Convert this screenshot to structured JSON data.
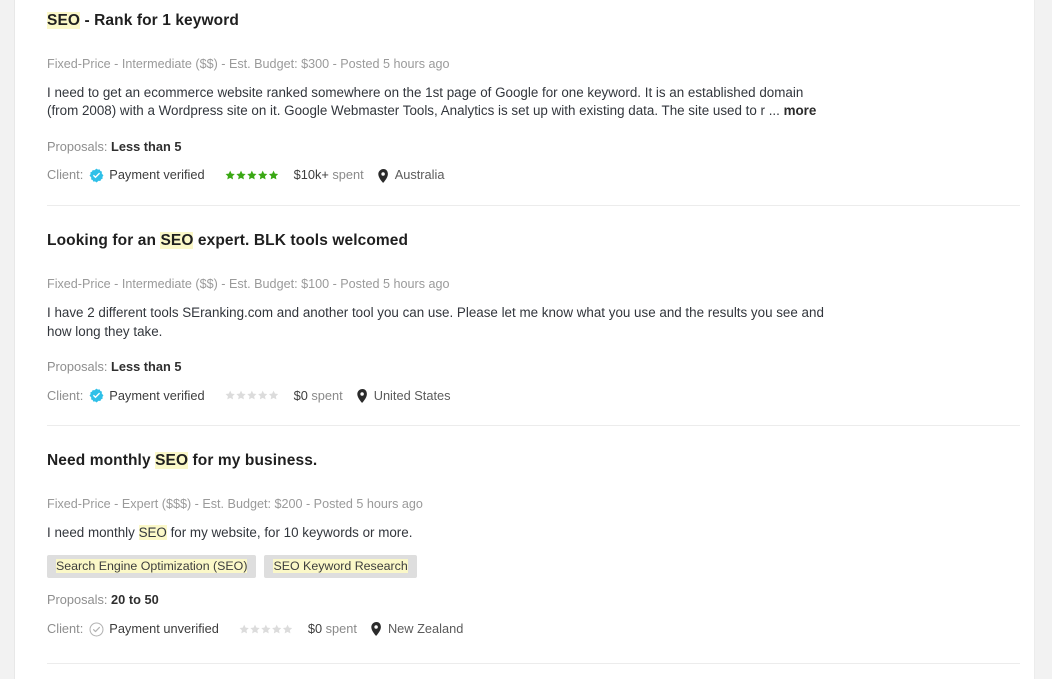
{
  "accent_colors": {
    "highlight": "#fbf8c8",
    "verified_badge": "#2fc0e8",
    "unverified_badge": "#b3b3b3",
    "star_filled": "#3aa814",
    "star_empty": "#dcdcdc",
    "tag_background": "#dedede",
    "panel_background": "#ffffff",
    "page_background": "#f2f2f2"
  },
  "labels": {
    "proposals_label": "Proposals:",
    "client_label": "Client:",
    "spent_suffix": "spent",
    "more_link": "more",
    "separator_dash": " - "
  },
  "jobs": [
    {
      "title_parts": [
        {
          "text": "SEO",
          "highlight": true
        },
        {
          "text": " - Rank for 1 keyword",
          "highlight": false
        }
      ],
      "title_plain": "SEO - Rank for 1 keyword",
      "meta": {
        "type": "Fixed-Price",
        "experience": "Intermediate ($$)",
        "budget": "Est. Budget: $300",
        "posted": "Posted 5 hours ago",
        "full": "Fixed-Price - Intermediate ($$) - Est. Budget: $300 - Posted 5 hours ago"
      },
      "description_parts": [
        {
          "text": "I need to get an ecommerce website ranked somewhere on the 1st page of Google for one keyword. It is an established domain (from 2008) with a Wordpress site on it. Google Webmaster Tools, Analytics is set up with existing data. The site used to r ... ",
          "highlight": false
        }
      ],
      "has_more_link": true,
      "skills": [],
      "proposals": "Less than 5",
      "client": {
        "payment_status": "Payment verified",
        "verified": true,
        "rating": 5,
        "spent": "$10k+",
        "location": "Australia"
      }
    },
    {
      "title_parts": [
        {
          "text": "Looking for an ",
          "highlight": false
        },
        {
          "text": "SEO",
          "highlight": true
        },
        {
          "text": " expert. BLK tools welcomed",
          "highlight": false
        }
      ],
      "title_plain": "Looking for an SEO expert. BLK tools welcomed",
      "meta": {
        "type": "Fixed-Price",
        "experience": "Intermediate ($$)",
        "budget": "Est. Budget: $100",
        "posted": "Posted 5 hours ago",
        "full": "Fixed-Price - Intermediate ($$) - Est. Budget: $100 - Posted 5 hours ago"
      },
      "description_parts": [
        {
          "text": "I have 2 different tools SEranking.com and another tool you can use. Please let me know what you use and the results you see and how long they take.",
          "highlight": false
        }
      ],
      "has_more_link": false,
      "skills": [],
      "proposals": "Less than 5",
      "client": {
        "payment_status": "Payment verified",
        "verified": true,
        "rating": 0,
        "spent": "$0",
        "location": "United States"
      }
    },
    {
      "title_parts": [
        {
          "text": "Need monthly ",
          "highlight": false
        },
        {
          "text": "SEO",
          "highlight": true
        },
        {
          "text": " for my business.",
          "highlight": false
        }
      ],
      "title_plain": "Need monthly SEO for my business.",
      "meta": {
        "type": "Fixed-Price",
        "experience": "Expert ($$$)",
        "budget": "Est. Budget: $200",
        "posted": "Posted 5 hours ago",
        "full": "Fixed-Price - Expert ($$$) - Est. Budget: $200 - Posted 5 hours ago"
      },
      "description_parts": [
        {
          "text": "I need monthly ",
          "highlight": false
        },
        {
          "text": "SEO",
          "highlight": true
        },
        {
          "text": " for my website, for 10 keywords or more.",
          "highlight": false
        }
      ],
      "has_more_link": false,
      "skills": [
        {
          "text": "Search Engine Optimization (SEO)",
          "highlight": true
        },
        {
          "text": "SEO Keyword Research",
          "highlight": true
        }
      ],
      "proposals": "20 to 50",
      "client": {
        "payment_status": "Payment unverified",
        "verified": false,
        "rating": 0,
        "spent": "$0",
        "location": "New Zealand"
      }
    }
  ]
}
